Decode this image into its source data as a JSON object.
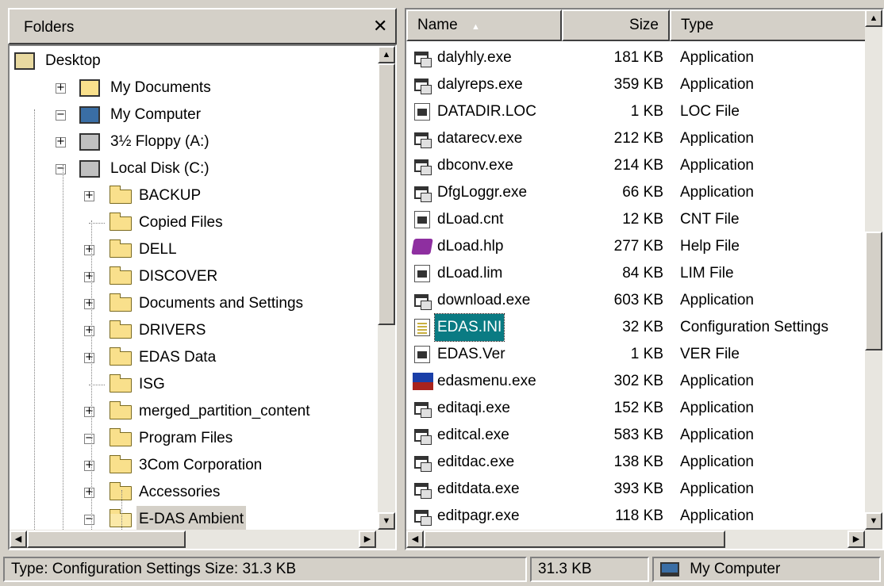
{
  "folders_pane": {
    "title": "Folders",
    "close_symbol": "✕",
    "tree": [
      {
        "label": "Desktop",
        "icon": "desktop-icon"
      },
      {
        "label": "My Documents",
        "icon": "my-documents-icon",
        "expander": "+"
      },
      {
        "label": "My Computer",
        "icon": "my-computer-icon",
        "expander": "−"
      },
      {
        "label": "3½ Floppy (A:)",
        "icon": "floppy-drive-icon",
        "expander": "+"
      },
      {
        "label": "Local Disk (C:)",
        "icon": "hard-drive-icon",
        "expander": "−"
      },
      {
        "label": "BACKUP",
        "icon": "folder-icon",
        "expander": "+"
      },
      {
        "label": "Copied Files",
        "icon": "folder-icon"
      },
      {
        "label": "DELL",
        "icon": "folder-icon",
        "expander": "+"
      },
      {
        "label": "DISCOVER",
        "icon": "folder-icon",
        "expander": "+"
      },
      {
        "label": "Documents and Settings",
        "icon": "folder-icon",
        "expander": "+"
      },
      {
        "label": "DRIVERS",
        "icon": "folder-icon",
        "expander": "+"
      },
      {
        "label": "EDAS Data",
        "icon": "folder-icon",
        "expander": "+"
      },
      {
        "label": "ISG",
        "icon": "folder-icon"
      },
      {
        "label": "merged_partition_content",
        "icon": "folder-icon",
        "expander": "+"
      },
      {
        "label": "Program Files",
        "icon": "folder-icon",
        "expander": "−"
      },
      {
        "label": "3Com Corporation",
        "icon": "folder-icon",
        "expander": "+"
      },
      {
        "label": "Accessories",
        "icon": "folder-icon",
        "expander": "+"
      },
      {
        "label": "E-DAS Ambient",
        "icon": "open-folder-icon",
        "expander": "−",
        "selected": true
      }
    ]
  },
  "file_list": {
    "columns": {
      "name": "Name",
      "size": "Size",
      "type": "Type",
      "sort_indicator": "▲"
    },
    "files": [
      {
        "name": "dalyhly.exe",
        "size": "181 KB",
        "type": "Application",
        "icon": "application-icon"
      },
      {
        "name": "dalyreps.exe",
        "size": "359 KB",
        "type": "Application",
        "icon": "application-icon"
      },
      {
        "name": "DATADIR.LOC",
        "size": "1 KB",
        "type": "LOC File",
        "icon": "generic-file-icon"
      },
      {
        "name": "datarecv.exe",
        "size": "212 KB",
        "type": "Application",
        "icon": "application-icon"
      },
      {
        "name": "dbconv.exe",
        "size": "214 KB",
        "type": "Application",
        "icon": "application-icon"
      },
      {
        "name": "DfgLoggr.exe",
        "size": "66 KB",
        "type": "Application",
        "icon": "application-icon"
      },
      {
        "name": "dLoad.cnt",
        "size": "12 KB",
        "type": "CNT File",
        "icon": "generic-file-icon"
      },
      {
        "name": "dLoad.hlp",
        "size": "277 KB",
        "type": "Help File",
        "icon": "help-file-icon"
      },
      {
        "name": "dLoad.lim",
        "size": "84 KB",
        "type": "LIM File",
        "icon": "generic-file-icon"
      },
      {
        "name": "download.exe",
        "size": "603 KB",
        "type": "Application",
        "icon": "application-icon"
      },
      {
        "name": "EDAS.INI",
        "size": "32 KB",
        "type": "Configuration Settings",
        "icon": "config-settings-icon",
        "selected": true
      },
      {
        "name": "EDAS.Ver",
        "size": "1 KB",
        "type": "VER File",
        "icon": "generic-file-icon"
      },
      {
        "name": "edasmenu.exe",
        "size": "302 KB",
        "type": "Application",
        "icon": "edasmenu-app-icon"
      },
      {
        "name": "editaqi.exe",
        "size": "152 KB",
        "type": "Application",
        "icon": "application-icon"
      },
      {
        "name": "editcal.exe",
        "size": "583 KB",
        "type": "Application",
        "icon": "application-icon"
      },
      {
        "name": "editdac.exe",
        "size": "138 KB",
        "type": "Application",
        "icon": "application-icon"
      },
      {
        "name": "editdata.exe",
        "size": "393 KB",
        "type": "Application",
        "icon": "application-icon"
      },
      {
        "name": "editpagr.exe",
        "size": "118 KB",
        "type": "Application",
        "icon": "application-icon"
      }
    ]
  },
  "status_bar": {
    "description": "Type: Configuration Settings Size: 31.3 KB",
    "size": "31.3 KB",
    "location": "My Computer"
  },
  "scroll_glyphs": {
    "up": "▲",
    "down": "▼",
    "left": "◀",
    "right": "▶"
  },
  "colors": {
    "window_face": "#d4d0c8",
    "selection": "#0a7b83"
  }
}
